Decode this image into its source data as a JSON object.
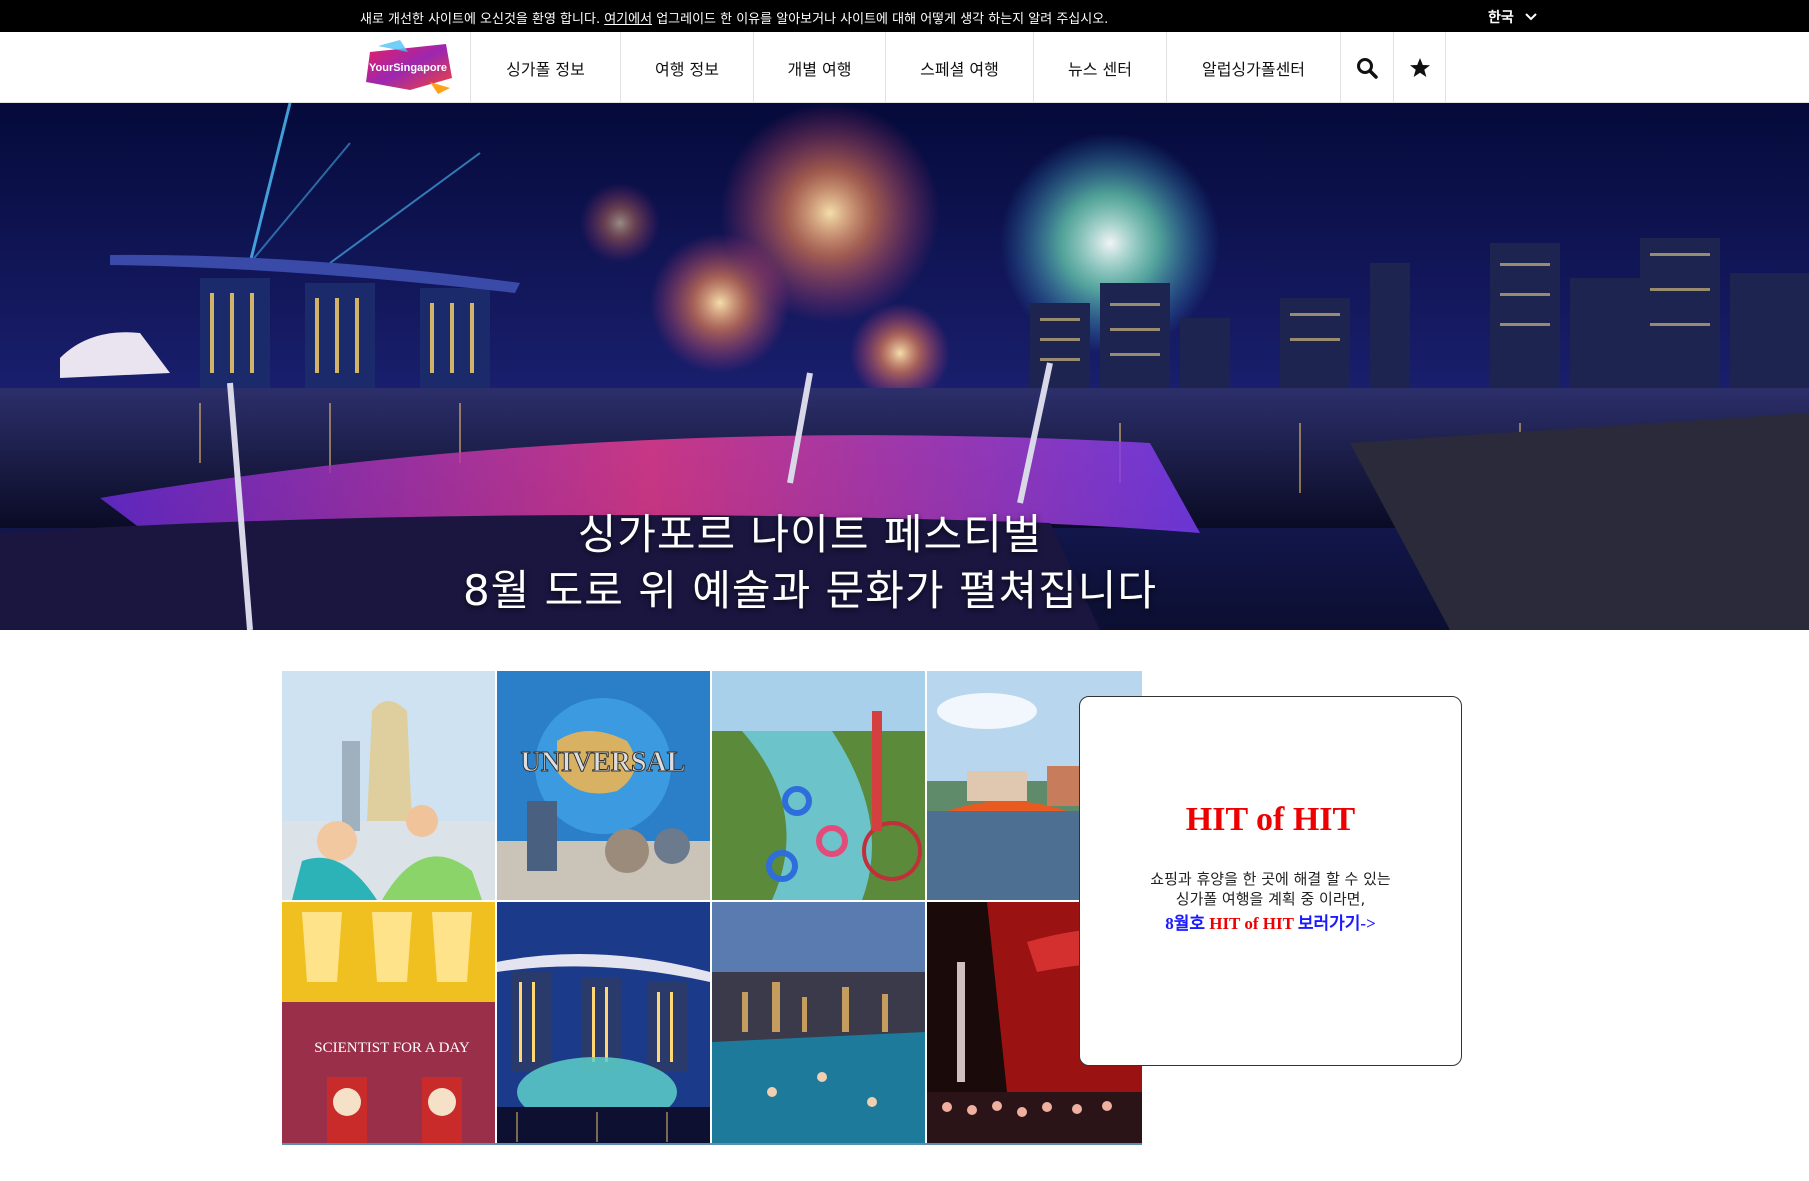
{
  "notice": {
    "text_before": "새로 개선한 사이트에 오신것을 환영 합니다. ",
    "link": "여기에서",
    "text_after": " 업그레이드 한 이유를 알아보거나 사이트에 대해 어떻게 생각 하는지 알려 주십시오."
  },
  "language": {
    "selected": "한국",
    "icon": "chevron-down-icon"
  },
  "logo": {
    "text": "YourSingapore"
  },
  "nav": {
    "items": [
      {
        "label": "싱가폴 정보"
      },
      {
        "label": "여행 정보"
      },
      {
        "label": "개별 여행"
      },
      {
        "label": "스페셜 여행"
      },
      {
        "label": "뉴스 센터"
      },
      {
        "label": "알럽싱가폴센터"
      }
    ],
    "search_icon": "search-icon",
    "favorite_icon": "star-icon"
  },
  "hero": {
    "line1": "싱가포르 나이트 페스티벌",
    "line2": "8월 도로 위 예술과 문화가 펼쳐집니다"
  },
  "gallery": {
    "tiles": [
      {
        "name": "merlion-tile",
        "text": ""
      },
      {
        "name": "universal-studios-tile",
        "text": "UNIVERSAL"
      },
      {
        "name": "water-park-tile",
        "text": ""
      },
      {
        "name": "sentosa-tile",
        "text": ""
      },
      {
        "name": "science-centre-tile",
        "text": "SCIENTIST FOR A DAY"
      },
      {
        "name": "marina-bay-sands-tile",
        "text": ""
      },
      {
        "name": "infinity-pool-tile",
        "text": ""
      },
      {
        "name": "night-event-tile",
        "text": ""
      }
    ]
  },
  "hit": {
    "title": "HIT of HIT",
    "desc_line1": "쇼핑과 휴양을 한 곳에 해결 할 수 있는",
    "desc_line2": "싱가폴 여행을 계획 중 이라면,",
    "link_prefix": "8월호 ",
    "link_highlight": "HIT of HIT",
    "link_suffix": " 보러가기->"
  },
  "colors": {
    "notice_bg": "#000000",
    "hit_title": "#ee0000",
    "hit_link": "#1a1aff",
    "logo_gradient_start": "#c2185b",
    "logo_gradient_end": "#7b1fa2"
  }
}
